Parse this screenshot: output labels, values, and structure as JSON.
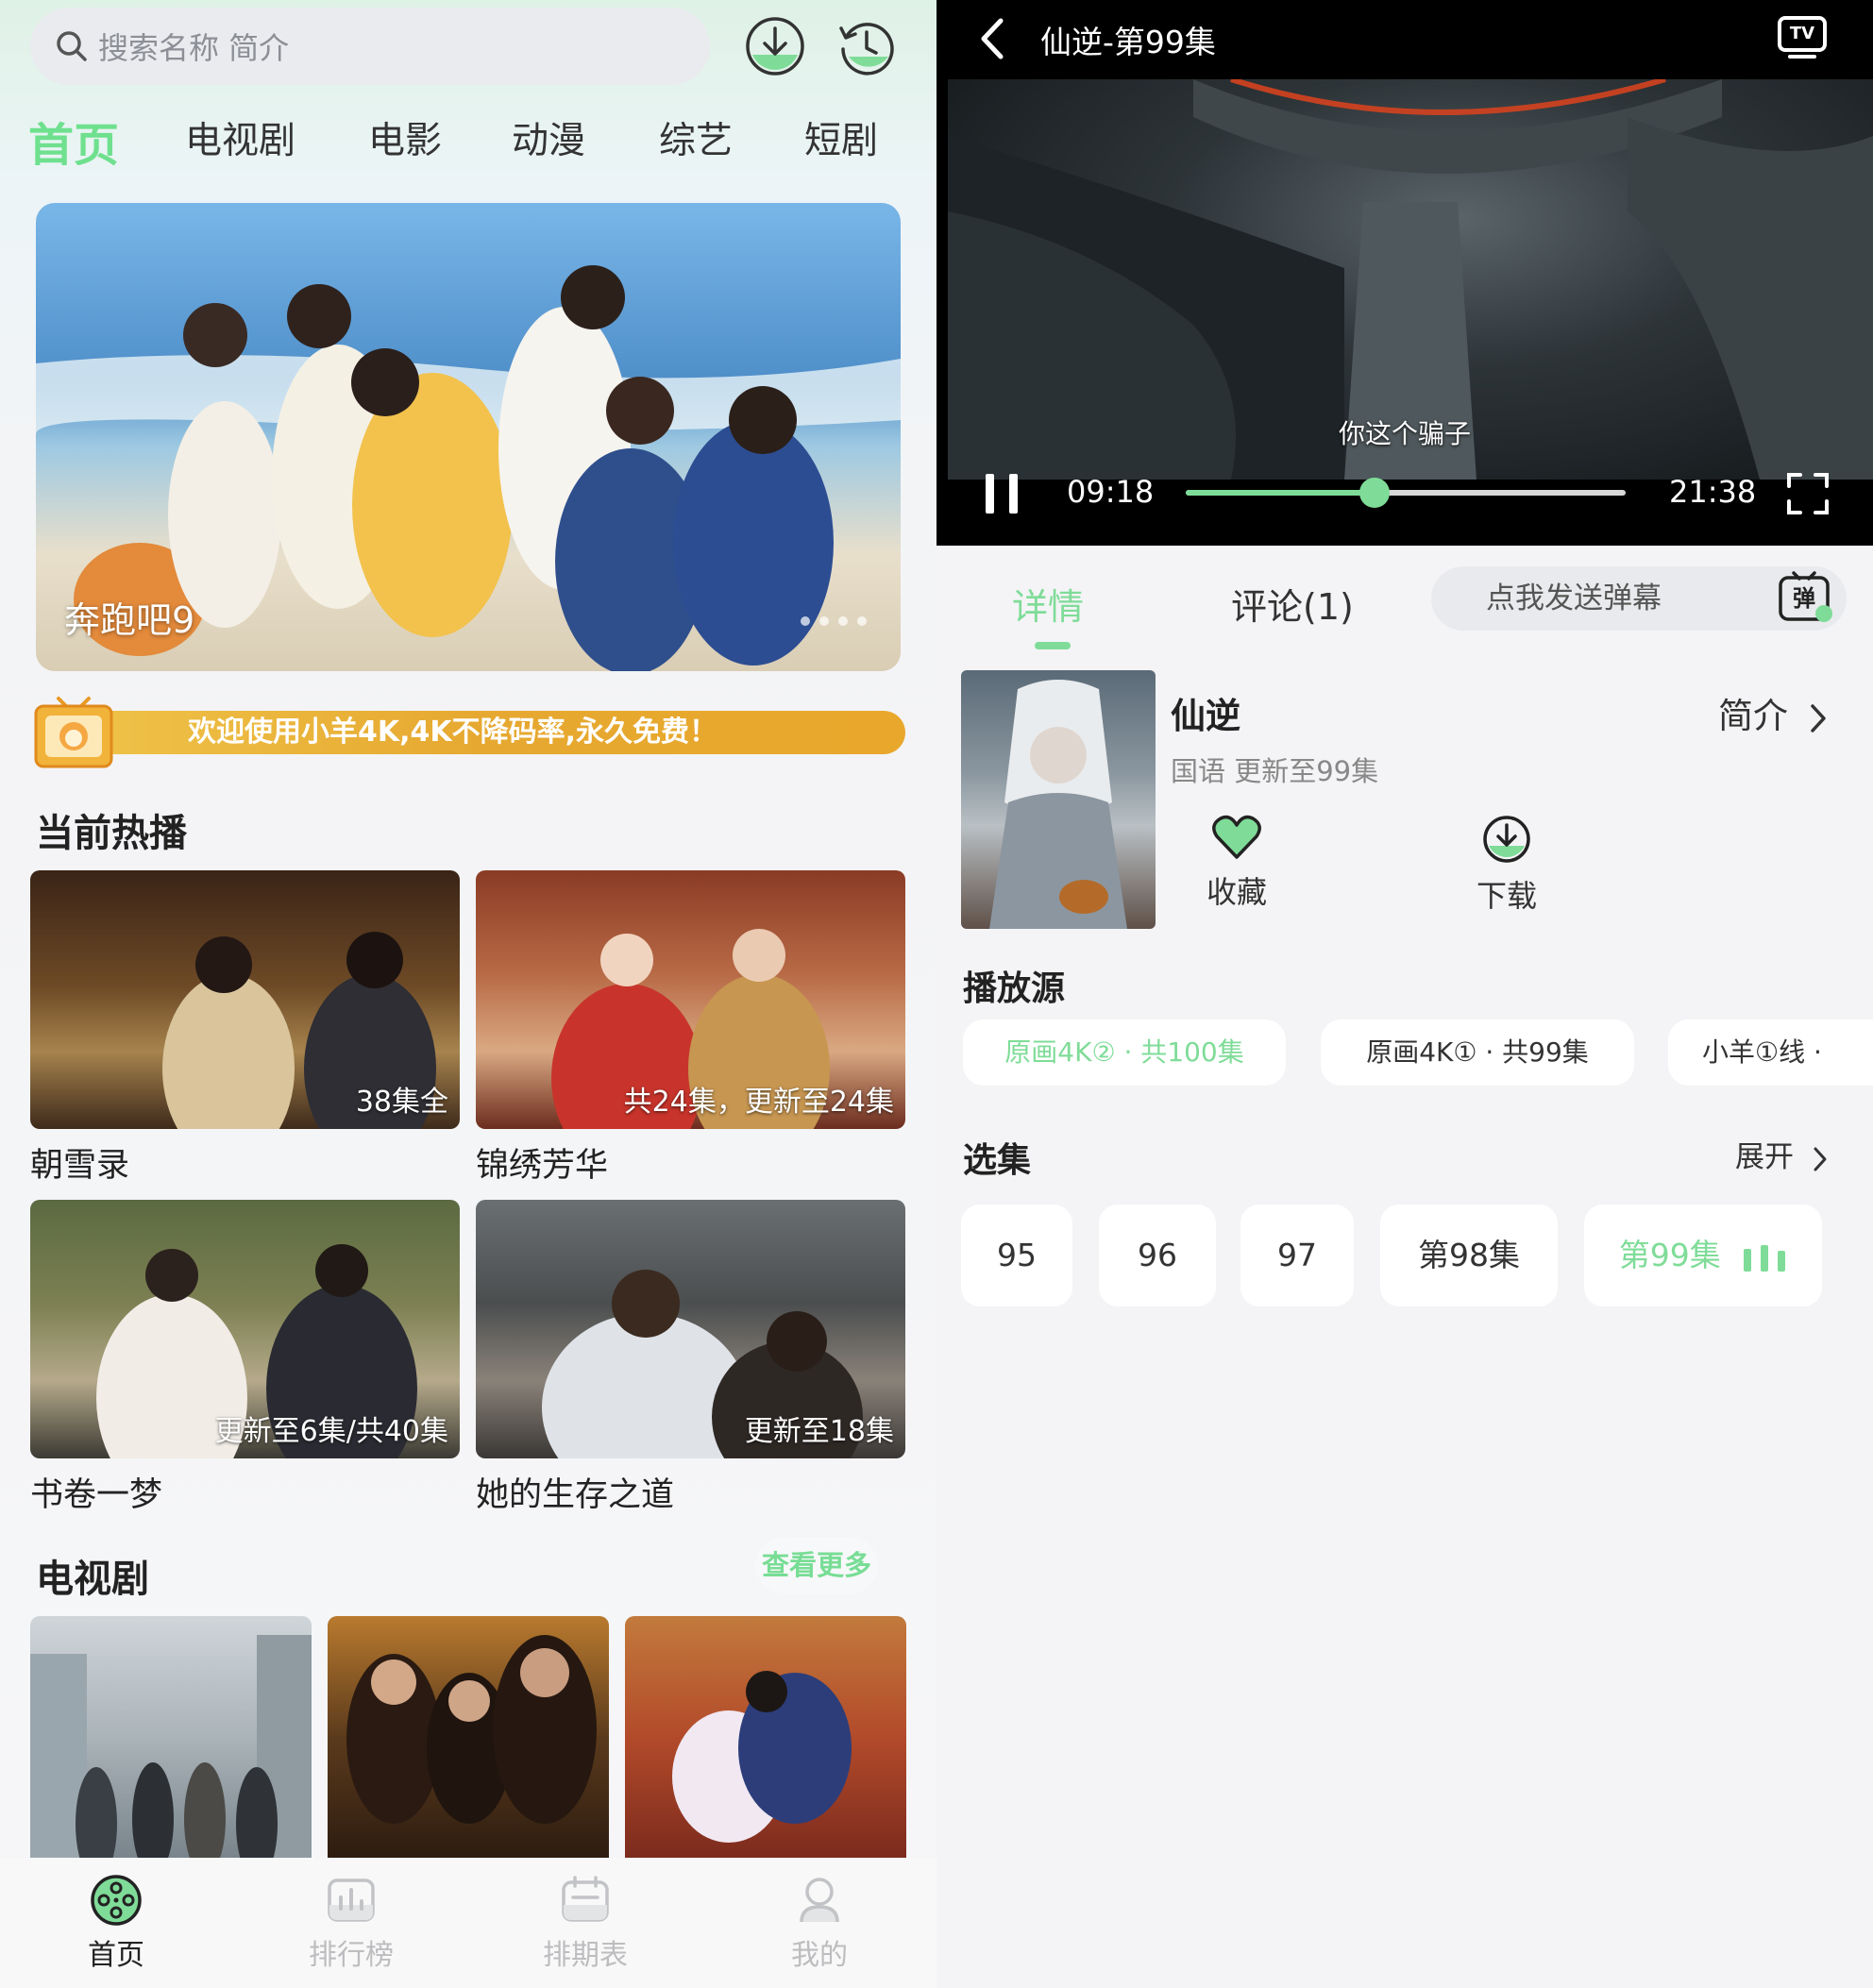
{
  "home": {
    "search_placeholder": "搜索名称 简介",
    "categories": [
      "首页",
      "电视剧",
      "电影",
      "动漫",
      "综艺",
      "短剧"
    ],
    "banner": {
      "title": "奔跑吧9"
    },
    "promo": "欢迎使用小羊4K,4K不降码率,永久免费！",
    "hot": {
      "title": "当前热播",
      "items": [
        {
          "name": "朝雪录",
          "badge": "38集全"
        },
        {
          "name": "锦绣芳华",
          "badge": "共24集，更新至24集"
        },
        {
          "name": "书卷一梦",
          "badge": "更新至6集/共40集"
        },
        {
          "name": "她的生存之道",
          "badge": "更新至18集"
        }
      ]
    },
    "tv": {
      "title": "电视剧",
      "more": "查看更多"
    },
    "tabs": [
      "首页",
      "排行榜",
      "排期表",
      "我的"
    ]
  },
  "player": {
    "title": "仙逆-第99集",
    "subtitle": "你这个骗子",
    "current_time": "09:18",
    "total_time": "21:38",
    "progress": 0.43,
    "tabs": [
      "详情",
      "评论(1)"
    ],
    "danmu_placeholder": "点我发送弹幕",
    "danmu_icon_text": "弹",
    "tv_icon_text": "TV",
    "show": {
      "name": "仙逆",
      "meta": "国语 更新至99集",
      "intro": "简介"
    },
    "actions": [
      "收藏",
      "下载"
    ],
    "sources_title": "播放源",
    "sources": [
      "原画4K② · 共100集",
      "原画4K① · 共99集",
      "小羊①线 ·"
    ],
    "episodes_title": "选集",
    "expand": "展开",
    "episodes": [
      "95",
      "96",
      "97",
      "第98集",
      "第99集"
    ]
  },
  "colors": {
    "accent": "#7fdc98",
    "promo": "#e9a82c"
  }
}
